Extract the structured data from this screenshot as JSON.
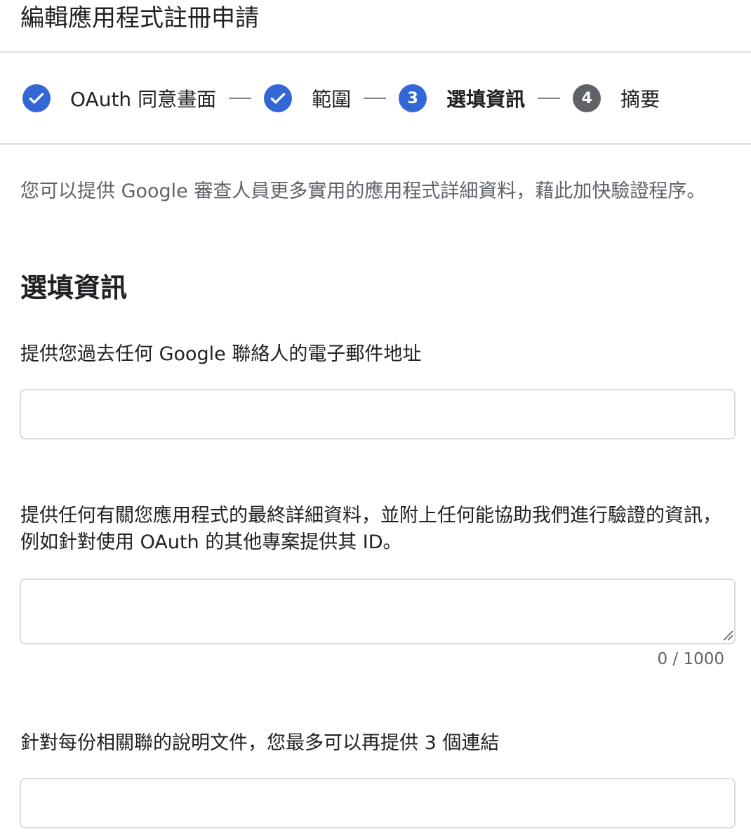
{
  "page": {
    "title": "編輯應用程式註冊申請"
  },
  "stepper": {
    "steps": [
      {
        "number": "",
        "label": "OAuth 同意畫面",
        "state": "done",
        "icon": "check-icon"
      },
      {
        "number": "",
        "label": "範圍",
        "state": "done",
        "icon": "check-icon"
      },
      {
        "number": "3",
        "label": "選填資訊",
        "state": "active"
      },
      {
        "number": "4",
        "label": "摘要",
        "state": "pending"
      }
    ]
  },
  "main": {
    "description": "您可以提供 Google 審查人員更多實用的應用程式詳細資料，藉此加快驗證程序。",
    "section_heading": "選填資訊",
    "fields": [
      {
        "label": "提供您過去任何 Google 聯絡人的電子郵件地址",
        "value": "",
        "placeholder": ""
      },
      {
        "label": "提供任何有關您應用程式的最終詳細資料，並附上任何能協助我們進行驗證的資訊，例如針對使用 OAuth 的其他專案提供其 ID。",
        "value": "",
        "placeholder": "",
        "counter": "0 / 1000"
      },
      {
        "label": "針對每份相關聯的說明文件，您最多可以再提供 3 個連結",
        "value": "",
        "placeholder": ""
      }
    ]
  },
  "colors": {
    "accent": "#3367d6",
    "pending": "#5f6368",
    "divider": "#dadce0",
    "text_primary": "#202124",
    "text_secondary": "#5f6368"
  }
}
